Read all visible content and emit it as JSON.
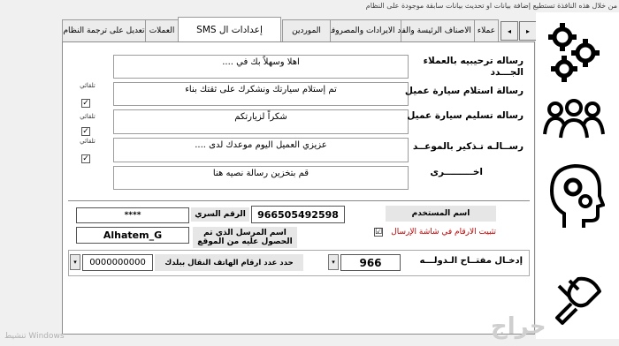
{
  "window": {
    "hint": "من خلال هذه النافذة تستطيع إضافة بيانات او تحديث بيانات سابقة موجودة على النظام",
    "watermark": "حراج",
    "activation_text": "تنشيط Windows"
  },
  "tabs": {
    "nav_next": "▸",
    "nav_prev": "◂",
    "items": [
      {
        "label": "عملاء"
      },
      {
        "label": "انواع الاصناف الرئيسة والفرعيه"
      },
      {
        "label": "بنود الايرادات والمصروفات"
      },
      {
        "label": "الموردين"
      },
      {
        "label": "إعدادات ال SMS"
      },
      {
        "label": "العملات"
      },
      {
        "label": "تعديل على ترجمة النظام"
      }
    ],
    "active_index": 4
  },
  "sms": {
    "rows": [
      {
        "label": "رساله ترحيبيه بالعملاء الجـــدد",
        "message": "اهلا وسهلاً بك في ....",
        "has_auto": false
      },
      {
        "label": "رسالة استلام سيارة عميل",
        "message": "تم إستلام سيارتك ونشكرك على ثقتك بناء",
        "has_auto": true,
        "auto_label": "تلقائي",
        "checked": true
      },
      {
        "label": "رساله تسليم سيارة عميل",
        "message": "شكراً لزيارتكم",
        "has_auto": true,
        "auto_label": "تلقائي",
        "checked": true
      },
      {
        "label": "رســالـه تـذكير بالموعــد",
        "message": "عزيزي العميل اليوم موعدك لدى ....",
        "has_auto": true,
        "auto_label": "تلقائي",
        "checked": true
      },
      {
        "label": "اخـــــــــرى",
        "message": "قم بتخزين رسالة نصيه هنا",
        "has_auto": false
      }
    ]
  },
  "account": {
    "username_label": "اسم المستخدم",
    "username_value": "966505492598",
    "password_label": "الرقم السري",
    "password_value": "****",
    "sender_label": "اسم المرسل الذي تم الحصول عليه من الموقع",
    "sender_value": "Alhatem_G",
    "fix_label": "تثبيت الارقام في شاشة الإرسال",
    "fix_checked": true
  },
  "phone": {
    "country_label": "إدخـال مفتــاح الـدولـــه",
    "country_code": "966",
    "digits_label": "حدد عدد ارقام الهاتف النقال ببلدك",
    "digits_value": "0000000000"
  },
  "sidebar": {
    "icons": [
      "gears-icon",
      "team-icon",
      "head-gears-icon",
      "plug-tools-icon"
    ]
  }
}
